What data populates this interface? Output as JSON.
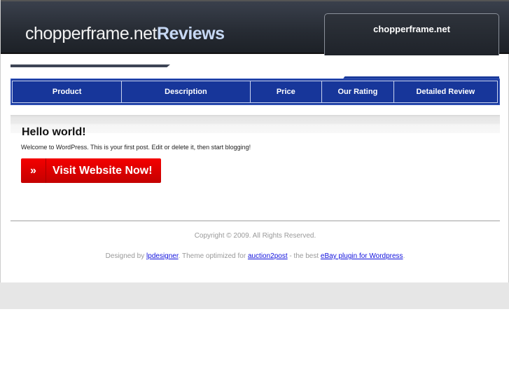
{
  "header": {
    "logo_main": "chopperframe.net",
    "logo_accent": "Reviews",
    "site_name": "chopperframe.net"
  },
  "nav": {
    "items": [
      {
        "label": "Product"
      },
      {
        "label": "Description"
      },
      {
        "label": "Price"
      },
      {
        "label": "Our Rating"
      },
      {
        "label": "Detailed Review"
      }
    ]
  },
  "post": {
    "title": "Hello world!",
    "body": "Welcome to WordPress. This is your first post. Edit or delete it, then start blogging!",
    "button_icon": "»",
    "button_label": "Visit Website Now!"
  },
  "footer": {
    "copyright": "Copyright © 2009. All Rights Reserved.",
    "designed_by": "Designed by ",
    "designer_link": "lpdesigner",
    "theme_text": ". Theme optimized for ",
    "auction_link": "auction2post",
    "best_text": " - the best ",
    "ebay_link": "eBay plugin for Wordpress",
    "end": "."
  }
}
